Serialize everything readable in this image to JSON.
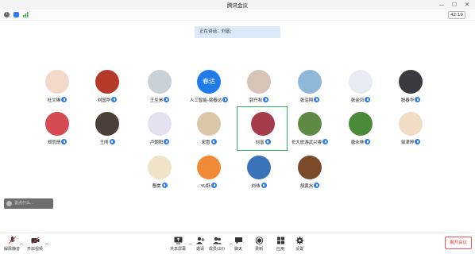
{
  "window": {
    "title": "腾讯会议",
    "timer": "42:19"
  },
  "banner": {
    "text": "正在讲话：刘富;"
  },
  "participants": [
    {
      "name": "杜文琳",
      "avatar_color": "#f2d9c9"
    },
    {
      "name": "刘国华",
      "avatar_color": "#b63a2a"
    },
    {
      "name": "王圣昊",
      "avatar_color": "#c9d1d6"
    },
    {
      "name": "人工智能-梁春达",
      "avatar_text": "春达",
      "avatar_color": "#1f7be7"
    },
    {
      "name": "郭丹秋",
      "avatar_color": "#d8c3b7"
    },
    {
      "name": "张沽翔",
      "avatar_color": "#8fb8d8"
    },
    {
      "name": "张金凤",
      "avatar_color": "#e7ecf2"
    },
    {
      "name": "殷春华",
      "avatar_color": "#3a3a40"
    },
    {
      "name": "郑雨晴",
      "avatar_color": "#d54a53"
    },
    {
      "name": "王闯",
      "avatar_color": "#4b4038"
    },
    {
      "name": "卢朝阳",
      "avatar_color": "#e6e1f0"
    },
    {
      "name": "宋雪",
      "avatar_color": "#d9c7a8"
    },
    {
      "name": "刘富",
      "avatar_color": "#a53b4b"
    },
    {
      "name": "长大旅游武兴睿",
      "avatar_color": "#5f8a46"
    },
    {
      "name": "唐永林",
      "avatar_color": "#4a8b3a"
    },
    {
      "name": "邹津婷",
      "avatar_color": "#f1dcc6"
    },
    {
      "name": "曹崴",
      "avatar_color": "#efe3c8"
    },
    {
      "name": "YU跃",
      "avatar_color": "#f08a37"
    },
    {
      "name": "刘伟",
      "avatar_color": "#3a73b7"
    },
    {
      "name": "胡黄水",
      "avatar_color": "#7b4a2b"
    }
  ],
  "chat": {
    "placeholder": "说点什么..."
  },
  "toolbar": {
    "mute": "解除静音",
    "video": "开启视频",
    "share": "共享屏幕",
    "invite": "邀请",
    "members": "成员(20)",
    "chat": "聊天",
    "record": "录制",
    "apps": "应用",
    "settings": "设置",
    "leave": "离开会议"
  },
  "colors": {
    "accent": "#2f7cf6",
    "active_border": "#33b062",
    "leave": "#e53333"
  }
}
